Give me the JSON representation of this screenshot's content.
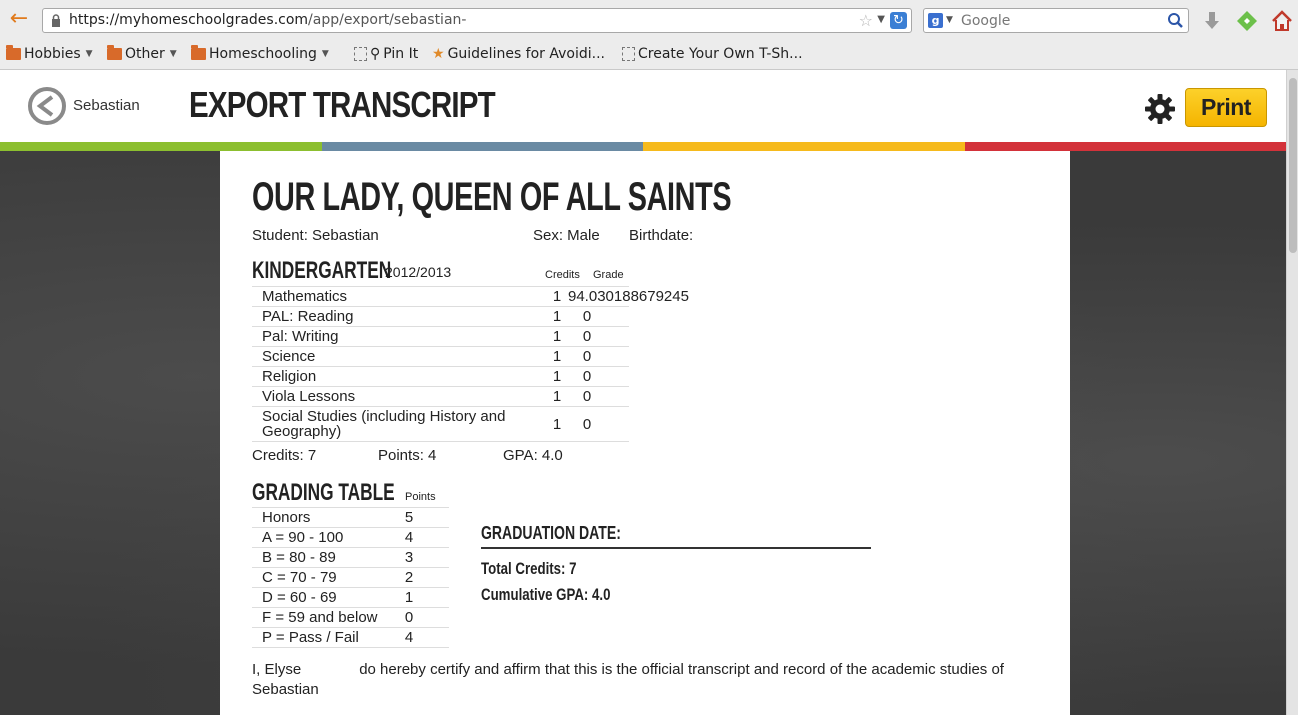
{
  "browser": {
    "url_host": "https://myhomeschoolgrades.com",
    "url_path": "/app/export/sebastian-",
    "search_placeholder": "Google",
    "bookmarks": [
      {
        "label": "Hobbies",
        "type": "folder"
      },
      {
        "label": "Other",
        "type": "folder"
      },
      {
        "label": "Homeschooling",
        "type": "folder"
      },
      {
        "label": "Pin It",
        "type": "page"
      },
      {
        "label": "Guidelines for Avoidi...",
        "type": "page"
      },
      {
        "label": "Create Your Own T-Sh...",
        "type": "page"
      }
    ]
  },
  "header": {
    "student": "Sebastian",
    "title": "EXPORT TRANSCRIPT",
    "print_label": "Print",
    "stripe_colors": [
      "#8cbf2f",
      "#6a8aa3",
      "#f6ba1c",
      "#d3323a"
    ]
  },
  "transcript": {
    "school": "OUR LADY, QUEEN OF ALL SAINTS",
    "student_line": "Student: Sebastian",
    "sex_line": "Sex: Male",
    "birthdate_line": "Birthdate:",
    "year": {
      "title": "KINDERGARTEN",
      "label": "2012/2013",
      "credits_header": "Credits",
      "grade_header": "Grade",
      "courses": [
        {
          "name": "Mathematics",
          "credits": "1",
          "grade": "94.030188679245"
        },
        {
          "name": "PAL: Reading",
          "credits": "1",
          "grade": "0"
        },
        {
          "name": "Pal: Writing",
          "credits": "1",
          "grade": "0"
        },
        {
          "name": "Science",
          "credits": "1",
          "grade": "0"
        },
        {
          "name": "Religion",
          "credits": "1",
          "grade": "0"
        },
        {
          "name": "Viola Lessons",
          "credits": "1",
          "grade": "0"
        },
        {
          "name": "Social Studies (including History and Geography)",
          "credits": "1",
          "grade": "0"
        }
      ],
      "credits_total": "Credits: 7",
      "points_total": "Points: 4",
      "gpa": "GPA: 4.0"
    },
    "grading": {
      "title": "GRADING TABLE",
      "points_header": "Points",
      "rows": [
        {
          "label": "Honors",
          "points": "5"
        },
        {
          "label": "A = 90 - 100",
          "points": "4"
        },
        {
          "label": "B = 80 - 89",
          "points": "3"
        },
        {
          "label": "C = 70 - 79",
          "points": "2"
        },
        {
          "label": "D = 60 - 69",
          "points": "1"
        },
        {
          "label": "F = 59 and below",
          "points": "0"
        },
        {
          "label": "P = Pass / Fail",
          "points": "4"
        }
      ]
    },
    "graduation_date": "GRADUATION DATE:",
    "total_credits": "Total Credits: 7",
    "cumulative_gpa": "Cumulative GPA: 4.0",
    "certify_prefix": "I, Elyse",
    "certify_text": "do hereby certify and affirm that this is the official transcript and record of the academic studies of Sebastian"
  }
}
